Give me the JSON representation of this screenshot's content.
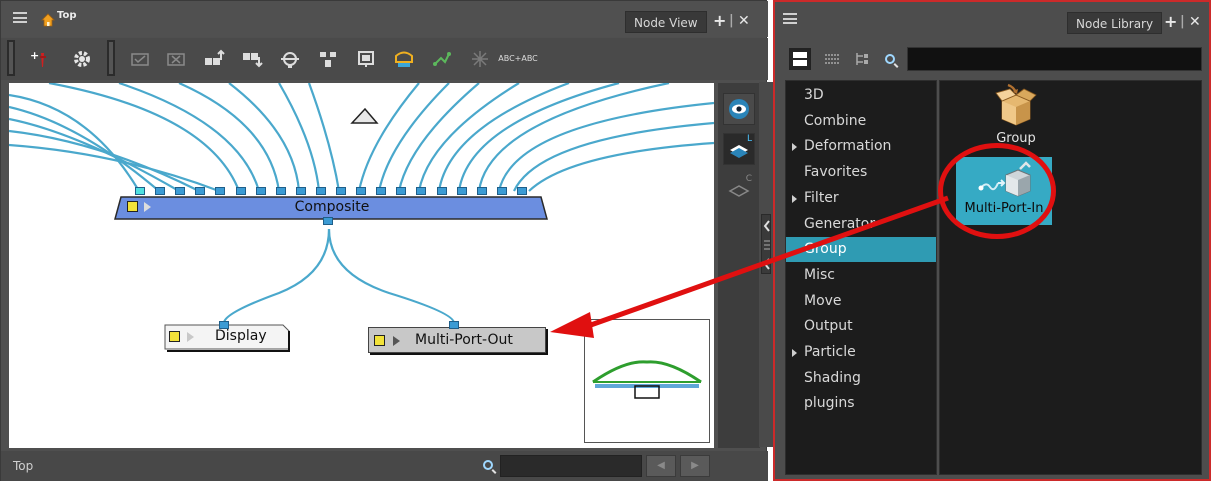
{
  "node_view": {
    "breadcrumb": "Top",
    "tab_label": "Node View",
    "add_btn": "+",
    "sep": "|",
    "close_btn": "✕",
    "toolbar_text_icon": "ABC+ABC",
    "nodes": {
      "composite": "Composite",
      "display": "Display",
      "multi_port_out": "Multi-Port-Out"
    },
    "strip_letters": {
      "l": "L",
      "c": "C"
    },
    "status_text": "Top"
  },
  "node_library": {
    "tab_label": "Node Library",
    "add_btn": "+",
    "sep": "|",
    "close_btn": "✕",
    "categories": [
      {
        "label": "3D",
        "has_children": false,
        "selected": false
      },
      {
        "label": "Combine",
        "has_children": false,
        "selected": false
      },
      {
        "label": "Deformation",
        "has_children": true,
        "selected": false
      },
      {
        "label": "Favorites",
        "has_children": false,
        "selected": false
      },
      {
        "label": "Filter",
        "has_children": true,
        "selected": false
      },
      {
        "label": "Generator",
        "has_children": false,
        "selected": false
      },
      {
        "label": "Group",
        "has_children": false,
        "selected": true
      },
      {
        "label": "Misc",
        "has_children": false,
        "selected": false
      },
      {
        "label": "Move",
        "has_children": false,
        "selected": false
      },
      {
        "label": "Output",
        "has_children": false,
        "selected": false
      },
      {
        "label": "Particle",
        "has_children": true,
        "selected": false
      },
      {
        "label": "Shading",
        "has_children": false,
        "selected": false
      },
      {
        "label": "plugins",
        "has_children": false,
        "selected": false
      }
    ],
    "items": [
      {
        "label": "Group",
        "selected": false
      },
      {
        "label": "Multi-Port-In",
        "selected": true
      }
    ]
  },
  "colors": {
    "accent": "#2f9bb3",
    "highlight_red": "#e01010",
    "composite_node": "#6b8ee0",
    "port": "#3b9bd4",
    "cable": "#4aa8cc"
  }
}
